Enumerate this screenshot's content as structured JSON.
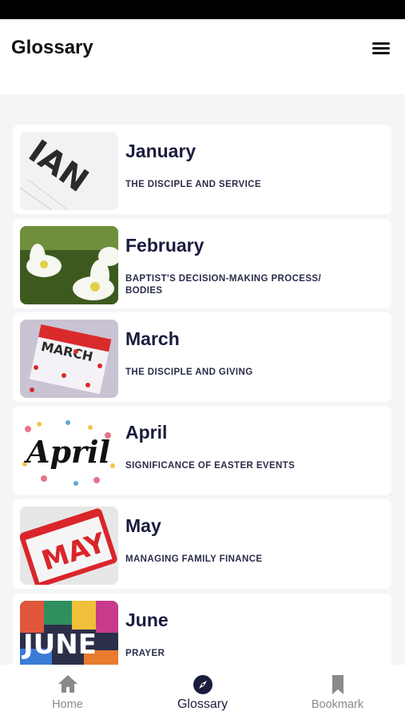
{
  "header": {
    "title": "Glossary"
  },
  "months": [
    {
      "title": "January",
      "subtitle": "THE DISCIPLE AND SERVICE"
    },
    {
      "title": "February",
      "subtitle": "BAPTIST'S DECISION-MAKING PROCESS/ BODIES"
    },
    {
      "title": "March",
      "subtitle": "THE DISCIPLE AND GIVING"
    },
    {
      "title": "April",
      "subtitle": "SIGNIFICANCE OF EASTER EVENTS"
    },
    {
      "title": "May",
      "subtitle": "MANAGING FAMILY FINANCE"
    },
    {
      "title": "June",
      "subtitle": "PRAYER"
    }
  ],
  "tabs": [
    {
      "label": "Home",
      "icon": "home-icon"
    },
    {
      "label": "Glossary",
      "icon": "compass-icon",
      "active": true
    },
    {
      "label": "Bookmark",
      "icon": "bookmark-icon"
    }
  ],
  "colors": {
    "title": "#1a1c3e",
    "inactive_tab": "#8a8a8a",
    "background": "#f4f5f7"
  }
}
